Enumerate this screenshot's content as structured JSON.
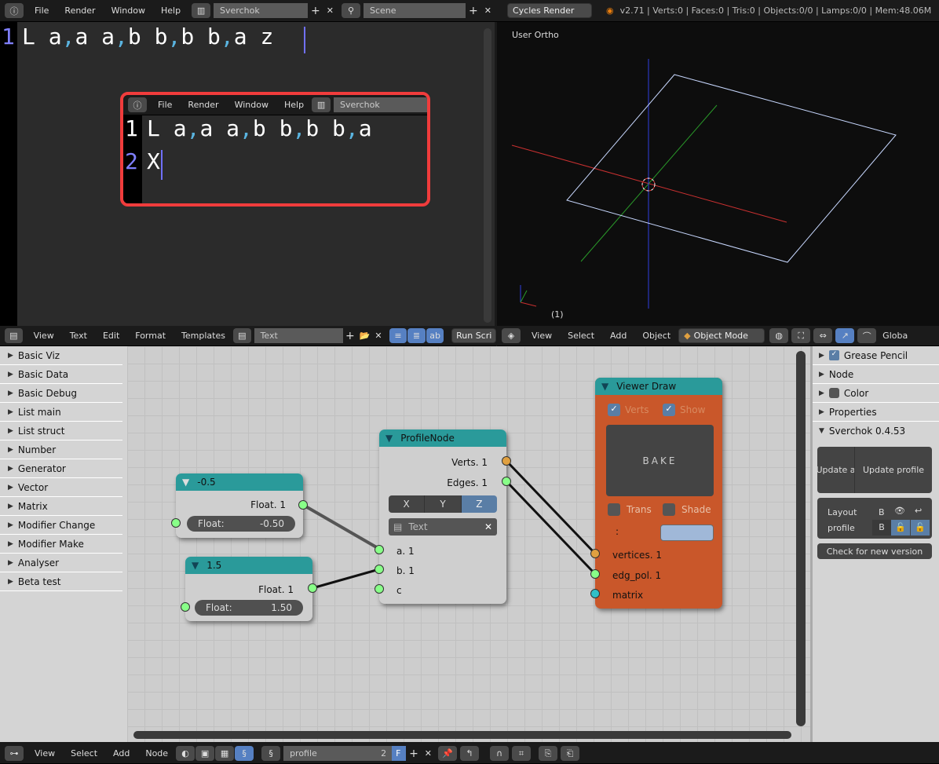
{
  "top_bar": {
    "menus": [
      "File",
      "Render",
      "Window",
      "Help"
    ],
    "screen": "Sverchok",
    "scene": "Scene",
    "engine": "Cycles Render",
    "stats": "v2.71 | Verts:0 | Faces:0 | Tris:0 | Objects:0/0 | Lamps:0/0 | Mem:48.06M"
  },
  "text_editor": {
    "lines": [
      {
        "num": "1",
        "text": "L a,a a,b b,b b,a z"
      }
    ],
    "inset": {
      "menus": [
        "File",
        "Render",
        "Window",
        "Help"
      ],
      "screen": "Sverchok",
      "lines": [
        {
          "num": "1",
          "text": "L a,a a,b b,b b,a"
        },
        {
          "num": "2",
          "text": "X"
        }
      ]
    },
    "header": {
      "menus": [
        "View",
        "Text",
        "Edit",
        "Format",
        "Templates"
      ],
      "datablock": "Text",
      "run_script": "Run Scri"
    }
  },
  "viewport": {
    "label": "User Ortho",
    "frame": "(1)",
    "header": {
      "menus": [
        "View",
        "Select",
        "Add",
        "Object"
      ],
      "mode": "Object Mode",
      "orientation": "Globa"
    },
    "colors": {
      "x": "#d03030",
      "y": "#30a030",
      "z": "#3040e0"
    }
  },
  "node_sidebar": [
    "Basic Viz",
    "Basic Data",
    "Basic Debug",
    "List main",
    "List struct",
    "Number",
    "Generator",
    "Vector",
    "Matrix",
    "Modifier Change",
    "Modifier Make",
    "Analyser",
    "Beta test"
  ],
  "nodes": {
    "float1": {
      "title": "-0.5",
      "out": "Float. 1",
      "label": "Float:",
      "value": "-0.50"
    },
    "float2": {
      "title": "1.5",
      "out": "Float. 1",
      "label": "Float:",
      "value": "1.50"
    },
    "profile": {
      "title": "ProfileNode",
      "outs": [
        "Verts. 1",
        "Edges. 1"
      ],
      "axes": [
        "X",
        "Y",
        "Z"
      ],
      "active_axis": "Z",
      "text": "Text",
      "ins": [
        "a. 1",
        "b. 1",
        "c"
      ]
    },
    "viewer": {
      "title": "Viewer Draw",
      "verts": "Verts",
      "show": "Show",
      "bake": "BAKE",
      "trans": "Trans",
      "shade": "Shade",
      "colon": ":",
      "ins": [
        "vertices. 1",
        "edg_pol. 1",
        "matrix"
      ],
      "color": "#c9572a"
    }
  },
  "right_panel": {
    "items": [
      "Grease Pencil",
      "Node",
      "Color",
      "Properties"
    ],
    "sverchok": "Sverchok 0.4.53",
    "update_all": "Update a",
    "update_profile": "Update profile",
    "layout": "Layout",
    "profile": "profile",
    "b": "B",
    "check": "Check for new version"
  },
  "bottom_bar": {
    "menus": [
      "View",
      "Select",
      "Add",
      "Node"
    ],
    "tree": "profile",
    "users": "2",
    "fake": "F"
  }
}
